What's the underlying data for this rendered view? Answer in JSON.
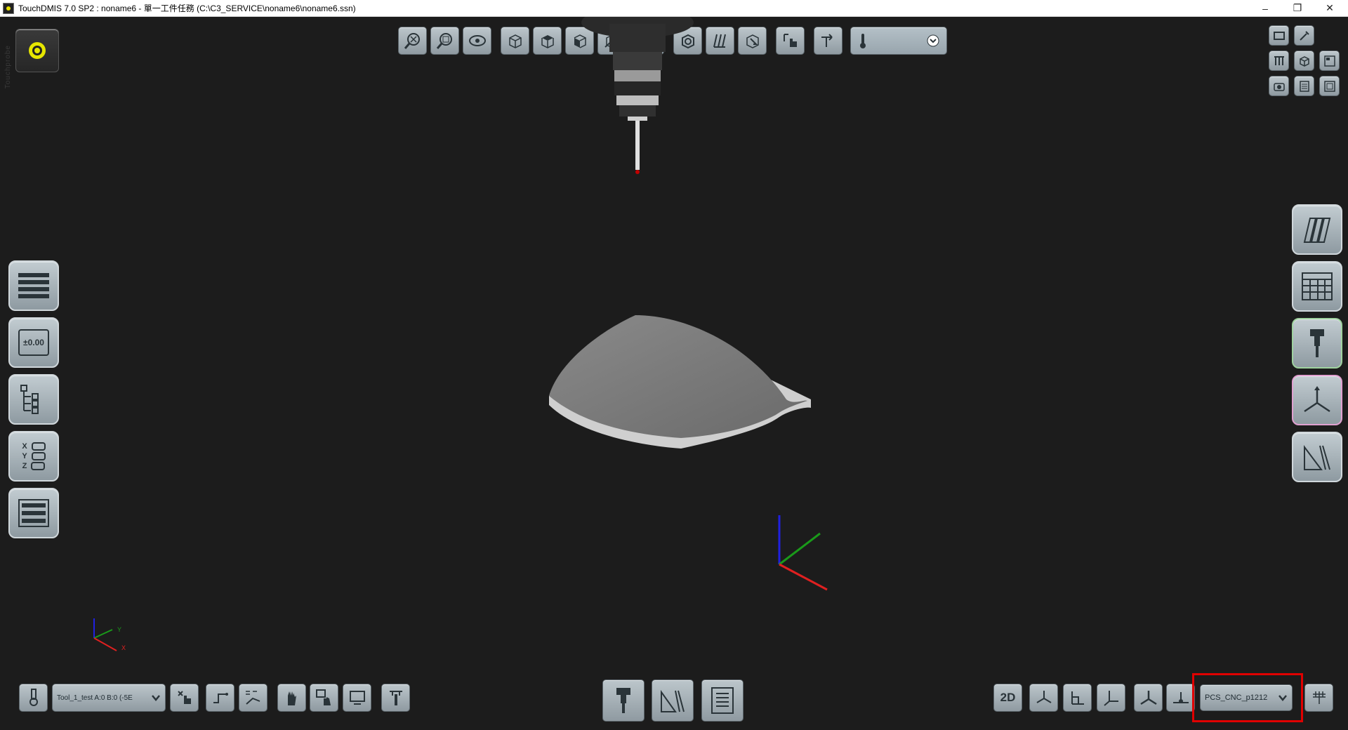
{
  "window": {
    "title": "TouchDMIS 7.0 SP2 : noname6 - 單一工件任務    (C:\\C3_SERVICE\\noname6\\noname6.ssn)",
    "minimize": "–",
    "restore": "❐",
    "close": "✕"
  },
  "left_rail_label": "Touchprobe",
  "status": {
    "indicator_color": "#e6e600"
  },
  "top_toolbar": {
    "temperature_placeholder": ""
  },
  "left_panel": {
    "tolerance_label": "±0.00",
    "xyz_labels": [
      "X",
      "Y",
      "Z"
    ]
  },
  "bottom_left": {
    "tool_select": "Tool_1_test A:0 B:0 (-5E"
  },
  "bottom_right": {
    "view_2d": "2D",
    "coord_system": "PCS_CNC_p1212"
  },
  "axes": {
    "x_label": "X",
    "y_label": "Y",
    "x_color": "#e02020",
    "y_color": "#1a9a1a",
    "z_color": "#2020e0"
  }
}
